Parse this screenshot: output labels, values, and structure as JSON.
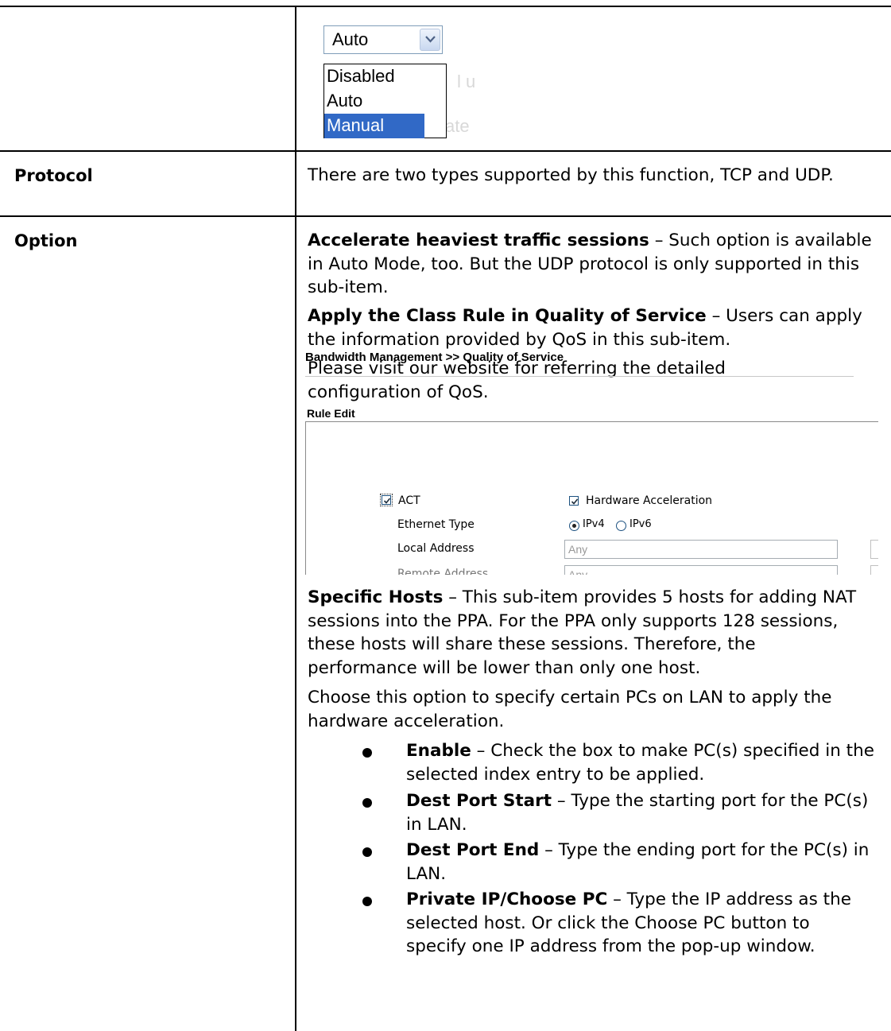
{
  "rows": {
    "protocol": {
      "label": "Protocol",
      "text": "There are two types supported by this function, TCP and UDP."
    },
    "option": {
      "label": "Option",
      "para1_bold": "Accelerate heaviest traffic sessions",
      "para1_rest": " – Such option is available in Auto Mode, too. But the UDP protocol is only supported in this sub-item.",
      "para2_bold": "Apply the Class Rule in Quality of Service",
      "para2_rest": " – Users can apply the information provided by QoS in this sub-item.",
      "para3": "Please visit our website for referring the detailed configuration of QoS.",
      "para4_bold": "Specific Hosts",
      "para4_rest": " – This sub-item provides 5 hosts for adding NAT sessions into the PPA. For the PPA only supports 128 sessions, these hosts will share these sessions. Therefore, the performance will be lower than only one host.",
      "para5": "Choose this option to specify certain PCs on LAN to apply the hardware acceleration.",
      "bullets": [
        {
          "bold": "Enable",
          "rest": " – Check the box to make PC(s) specified in the selected index entry to be applied."
        },
        {
          "bold": "Dest Port Start",
          "rest": " – Type the starting port for the PC(s) in LAN."
        },
        {
          "bold": "Dest Port End",
          "rest": " – Type the ending port for the PC(s) in LAN."
        },
        {
          "bold": "Private IP/Choose PC",
          "rest": " – Type the IP address as the selected host. Or click the Choose PC button to specify one IP address from the pop-up window."
        }
      ]
    }
  },
  "dropdown": {
    "selected": "Auto",
    "options": [
      "Disabled",
      "Auto",
      "Manual"
    ],
    "highlighted": "Manual",
    "ghost_text_1": "l u",
    "ghost_text_2": "ate"
  },
  "qos_screenshot": {
    "breadcrumb": "Bandwidth Management >> Quality of Service",
    "section": "Rule Edit",
    "act_label": "ACT",
    "act_checked": true,
    "hw_accel_label": "Hardware Acceleration",
    "hw_accel_checked": true,
    "ethernet_type_label": "Ethernet Type",
    "ipv4_label": "IPv4",
    "ipv6_label": "IPv6",
    "ethernet_type_selected": "IPv4",
    "local_address_label": "Local Address",
    "local_address_value": "Any",
    "remote_address_label": "Remote Address",
    "remote_address_value": "Any"
  },
  "icons": {
    "dropdown_arrow": "chevron-down-icon",
    "bullet": "bullet-dot-icon",
    "checkbox": "checkbox-checked-icon",
    "radio": "radio-button-icon"
  }
}
